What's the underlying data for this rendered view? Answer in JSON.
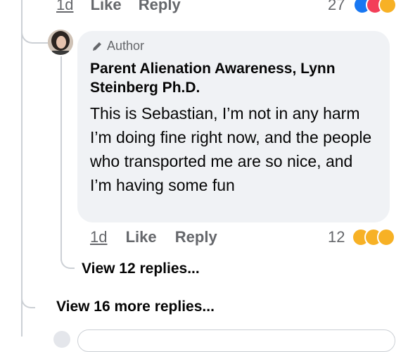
{
  "top_row": {
    "timestamp": "1d",
    "like": "Like",
    "reply": "Reply",
    "count": "27",
    "reaction_icons": [
      "like-icon",
      "love-icon",
      "care-icon"
    ]
  },
  "comment": {
    "badge_label": "Author",
    "author_name": "Parent Alienation Awareness, Lynn Steinberg Ph.D.",
    "text": "This is Sebastian, I’m not in any harm I’m doing fine right now, and the people who transported me are so nice, and I’m having some fun",
    "timestamp": "1d",
    "like": "Like",
    "reply": "Reply",
    "count": "12",
    "reaction_icons": [
      "haha-icon",
      "wow-icon",
      "sad-icon"
    ]
  },
  "view_replies": "View 12 replies...",
  "view_more": "View 16 more replies...",
  "colors": {
    "bubble": "#f0f2f5",
    "meta": "#65676b",
    "like_blue": "#1877f2",
    "love_red": "#f33e58",
    "emoji_yellow": "#f7b125"
  }
}
